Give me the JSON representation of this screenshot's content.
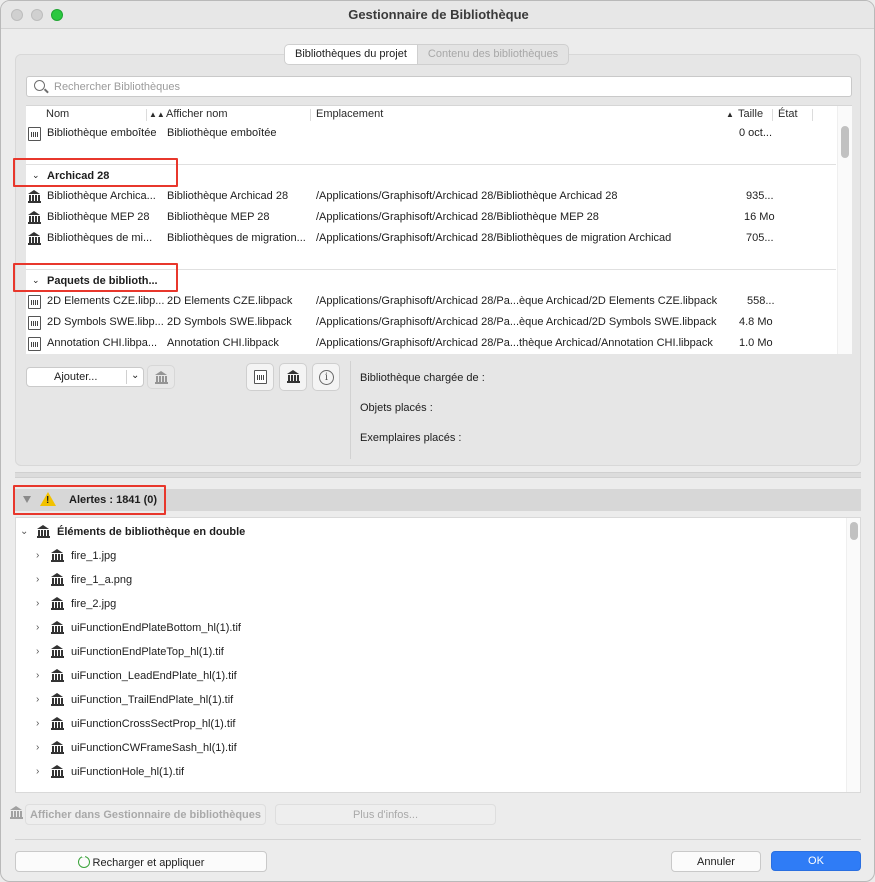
{
  "window": {
    "title": "Gestionnaire de Bibliothèque"
  },
  "tabs": [
    {
      "label": "Bibliothèques du projet",
      "active": true
    },
    {
      "label": "Contenu des bibliothèques",
      "active": false
    }
  ],
  "search": {
    "placeholder": "Rechercher Bibliothèques"
  },
  "table": {
    "headers": {
      "nom": "Nom",
      "afficher": "Afficher nom",
      "emplacement": "Emplacement",
      "taille": "Taille",
      "etat": "État"
    },
    "embedded": {
      "nom": "Bibliothèque emboîtée",
      "afficher": "Bibliothèque emboîtée",
      "emplacement": "",
      "taille": "0 oct..."
    },
    "groups": [
      {
        "label": "Archicad 28",
        "rows": [
          {
            "nom": "Bibliothèque Archica...",
            "afficher": "Bibliothèque Archicad 28",
            "emplacement": "/Applications/Graphisoft/Archicad 28/Bibliothèque Archicad 28",
            "taille": "935..."
          },
          {
            "nom": "Bibliothèque MEP 28",
            "afficher": "Bibliothèque MEP 28",
            "emplacement": "/Applications/Graphisoft/Archicad 28/Bibliothèque MEP 28",
            "taille": "16 Mo"
          },
          {
            "nom": "Bibliothèques de mi...",
            "afficher": "Bibliothèques de migration...",
            "emplacement": "/Applications/Graphisoft/Archicad 28/Bibliothèques de migration Archicad",
            "taille": "705..."
          }
        ]
      },
      {
        "label": "Paquets de biblioth...",
        "rows": [
          {
            "nom": "2D Elements CZE.libp...",
            "afficher": "2D Elements CZE.libpack",
            "emplacement": "/Applications/Graphisoft/Archicad 28/Pa...èque Archicad/2D Elements CZE.libpack",
            "taille": "558..."
          },
          {
            "nom": "2D Symbols SWE.libp...",
            "afficher": "2D Symbols SWE.libpack",
            "emplacement": "/Applications/Graphisoft/Archicad 28/Pa...èque Archicad/2D Symbols SWE.libpack",
            "taille": "4.8 Mo"
          },
          {
            "nom": "Annotation CHI.libpa...",
            "afficher": "Annotation CHI.libpack",
            "emplacement": "/Applications/Graphisoft/Archicad 28/Pa...thèque Archicad/Annotation CHI.libpack",
            "taille": "1.0 Mo"
          }
        ]
      }
    ]
  },
  "toolbar": {
    "add_label": "Ajouter..."
  },
  "info": {
    "loaded_from": "Bibliothèque chargée de :",
    "placed_objects": "Objets placés :",
    "placed_instances": "Exemplaires placés :"
  },
  "alerts": {
    "label": "Alertes : 1841 (0)",
    "section": "Éléments de bibliothèque en double",
    "items": [
      "fire_1.jpg",
      "fire_1_a.png",
      "fire_2.jpg",
      "uiFunctionEndPlateBottom_hl(1).tif",
      "uiFunctionEndPlateTop_hl(1).tif",
      "uiFunction_LeadEndPlate_hl(1).tif",
      "uiFunction_TrailEndPlate_hl(1).tif",
      "uiFunctionCrossSectProp_hl(1).tif",
      "uiFunctionCWFrameSash_hl(1).tif",
      "uiFunctionHole_hl(1).tif"
    ]
  },
  "bottom": {
    "show_in_manager": "Afficher dans Gestionnaire de bibliothèques",
    "more_info": "Plus d'infos...",
    "reload": "Recharger et appliquer",
    "cancel": "Annuler",
    "ok": "OK"
  },
  "colors": {
    "highlight": "#e8372c",
    "ok_button": "#2f7cf6",
    "warning": "#f2c200"
  }
}
